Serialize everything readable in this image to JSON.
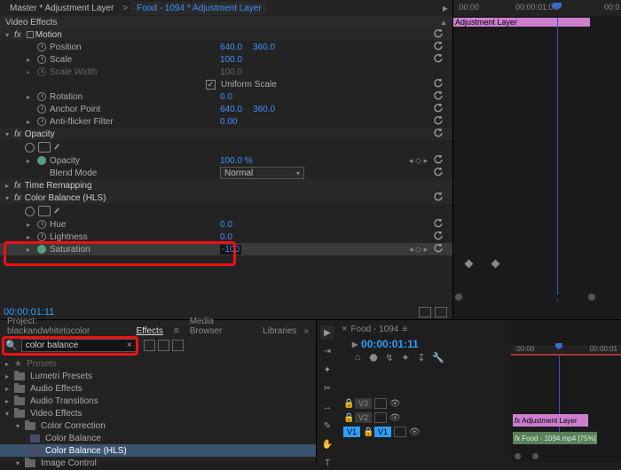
{
  "breadcrumb": {
    "master": "Master * Adjustment Layer",
    "clip": "Food - 1094 * Adjustment Layer"
  },
  "header": {
    "video_effects": "Video Effects"
  },
  "motion": {
    "name": "Motion",
    "position_label": "Position",
    "position_x": "640.0",
    "position_y": "360.0",
    "scale_label": "Scale",
    "scale_val": "100.0",
    "scale_width_label": "Scale Width",
    "scale_width_val": "100.0",
    "uniform_label": "Uniform Scale",
    "rotation_label": "Rotation",
    "rotation_val": "0.0",
    "anchor_label": "Anchor Point",
    "anchor_x": "640.0",
    "anchor_y": "360.0",
    "flicker_label": "Anti-flicker Filter",
    "flicker_val": "0.00"
  },
  "opacity": {
    "name": "Opacity",
    "opacity_label": "Opacity",
    "opacity_val": "100.0 %",
    "blend_label": "Blend Mode",
    "blend_val": "Normal"
  },
  "time_remap": {
    "name": "Time Remapping"
  },
  "color_balance": {
    "name": "Color Balance (HLS)",
    "hue_label": "Hue",
    "hue_val": "0.0",
    "lightness_label": "Lightness",
    "lightness_val": "0.0",
    "saturation_label": "Saturation",
    "saturation_val": "-100"
  },
  "timecode": "00:00:01:11",
  "timeline": {
    "t0": ":00:00",
    "t1": "00:00:01:00",
    "t2": "00:0",
    "adj_label": "Adjustment Layer"
  },
  "effects_panel": {
    "tabs": {
      "project": "Project: blackandwhitetocolor",
      "effects": "Effects",
      "media": "Media Browser",
      "libraries": "Libraries"
    },
    "search": "color balance",
    "tree": {
      "presets": "Presets",
      "lumetri": "Lumetri Presets",
      "audio_fx": "Audio Effects",
      "audio_tr": "Audio Transitions",
      "video_fx": "Video Effects",
      "color_corr": "Color Correction",
      "cb": "Color Balance",
      "cb_hls": "Color Balance (HLS)",
      "image_ctrl": "Image Control"
    }
  },
  "source": {
    "title": "Food - 1094",
    "tc": "00:00:01:11",
    "tracks": {
      "v3": "V3",
      "v2": "V2",
      "v1": "V1",
      "v1b": "V1"
    },
    "t0": ":00:00",
    "t1": "00:00:01"
  },
  "seq_clips": {
    "adj": "Adjustment Layer",
    "food": "Food - 1094.mp4 [75%]"
  }
}
